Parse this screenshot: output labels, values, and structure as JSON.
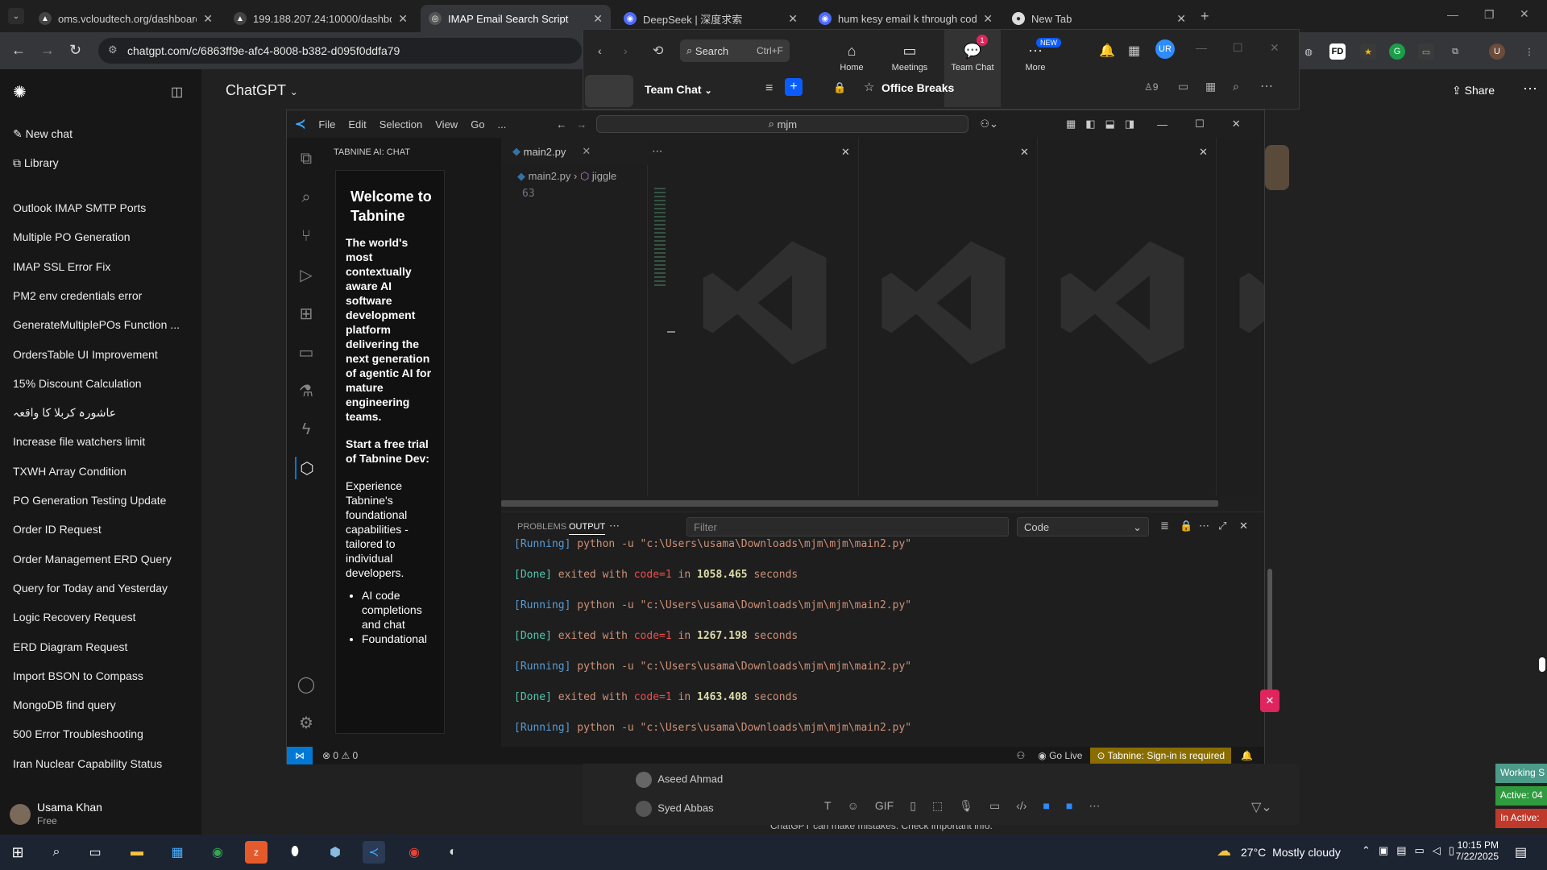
{
  "browser": {
    "tabs": [
      {
        "title": "oms.vcloudtech.org/dashboard",
        "active": false
      },
      {
        "title": "199.188.207.24:10000/dashboa",
        "active": false
      },
      {
        "title": "IMAP Email Search Script",
        "active": true
      },
      {
        "title": "DeepSeek | 深度求索",
        "active": false
      },
      {
        "title": "hum kesy email k through code",
        "active": false
      },
      {
        "title": "New Tab",
        "active": false
      }
    ],
    "url": "chatgpt.com/c/6863ff9e-afc4-8008-b382-d095f0ddfa79"
  },
  "chatgpt": {
    "header_title": "ChatGPT",
    "share_label": "Share",
    "new_chat": "New chat",
    "library": "Library",
    "history": [
      "Outlook IMAP SMTP Ports",
      "Multiple PO Generation",
      "IMAP SSL Error Fix",
      "PM2 env credentials error",
      "GenerateMultiplePOs Function ...",
      "OrdersTable UI Improvement",
      "15% Discount Calculation",
      "عاشورہ کربلا کا واقعہ",
      "Increase file watchers limit",
      "TXWH Array Condition",
      "PO Generation Testing Update",
      "Order ID Request",
      "Order Management ERD Query",
      "Query for Today and Yesterday",
      "Logic Recovery Request",
      "ERD Diagram Request",
      "Import BSON to Compass",
      "MongoDB find query",
      "500 Error Troubleshooting",
      "Iran Nuclear Capability Status"
    ],
    "user_name": "Usama Khan",
    "user_plan": "Free",
    "disclaimer": "ChatGPT can make mistakes. Check important info."
  },
  "zoom": {
    "search_label": "Search",
    "search_shortcut": "Ctrl+F",
    "nav": [
      {
        "label": "Home",
        "icon": "home-icon"
      },
      {
        "label": "Meetings",
        "icon": "video-icon"
      },
      {
        "label": "Team Chat",
        "icon": "chat-icon",
        "badge": "1"
      },
      {
        "label": "More",
        "icon": "more-icon",
        "badge": "NEW"
      }
    ],
    "avatar": "UR",
    "team_chat_label": "Team Chat",
    "channel": "Office Breaks",
    "member_count": "9",
    "members": [
      "Aseed Ahmad",
      "Syed Abbas"
    ]
  },
  "vscode": {
    "menu": [
      "File",
      "Edit",
      "Selection",
      "View",
      "Go",
      "..."
    ],
    "search": "mjm",
    "sidebar_title": "TABNINE AI: CHAT",
    "tab_file": "main2.py",
    "breadcrumb_file": "main2.py",
    "breadcrumb_symbol": "jiggle",
    "line_number": "63",
    "tabnine": {
      "heading": "Welcome to Tabnine",
      "intro": "The world's most contextually aware AI software development platform delivering the next generation of agentic AI for mature engineering teams.",
      "trial": "Start a free trial of Tabnine Dev:",
      "desc": "Experience Tabnine's foundational capabilities - tailored to individual developers.",
      "bullets": [
        "AI code completions and chat",
        "Foundational"
      ]
    },
    "panel_tabs": [
      "PROBLEMS",
      "OUTPUT"
    ],
    "filter_placeholder": "Filter",
    "output_channel": "Code",
    "output": [
      {
        "kind": "run",
        "tag": "[Running]",
        "text": "python -u \"c:\\Users\\usama\\Downloads\\mjm\\mjm\\main2.py\""
      },
      {
        "kind": "done",
        "tag": "[Done]",
        "pre": "exited with",
        "code": "code=1",
        "mid": "in",
        "secs": "1058.465",
        "post": "seconds"
      },
      {
        "kind": "run",
        "tag": "[Running]",
        "text": "python -u \"c:\\Users\\usama\\Downloads\\mjm\\mjm\\main2.py\""
      },
      {
        "kind": "done",
        "tag": "[Done]",
        "pre": "exited with",
        "code": "code=1",
        "mid": "in",
        "secs": "1267.198",
        "post": "seconds"
      },
      {
        "kind": "run",
        "tag": "[Running]",
        "text": "python -u \"c:\\Users\\usama\\Downloads\\mjm\\mjm\\main2.py\""
      },
      {
        "kind": "done",
        "tag": "[Done]",
        "pre": "exited with",
        "code": "code=1",
        "mid": "in",
        "secs": "1463.408",
        "post": "seconds"
      },
      {
        "kind": "run",
        "tag": "[Running]",
        "text": "python -u \"c:\\Users\\usama\\Downloads\\mjm\\mjm\\main2.py\""
      }
    ],
    "status": {
      "errors": "0",
      "warnings": "0",
      "golive": "Go Live",
      "tabnine": "Tabnine: Sign-in is required"
    }
  },
  "taskbar": {
    "weather": "27°C",
    "weather_desc": "Mostly cloudy",
    "time": "10:15 PM",
    "date": "7/22/2025",
    "side_labels": [
      "Working S",
      "Active: 04",
      "In Active:"
    ]
  }
}
